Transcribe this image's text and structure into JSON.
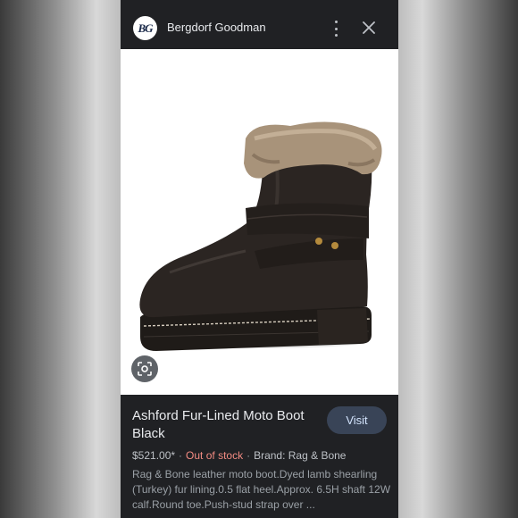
{
  "header": {
    "logo_text": "BG",
    "site_name": "Bergdorf Goodman"
  },
  "icons": {
    "more": "more-vert-icon",
    "close": "close-icon",
    "lens": "lens-search-icon"
  },
  "product": {
    "title": "Ashford Fur-Lined Moto Boot Black",
    "visit_label": "Visit",
    "price": "$521.00*",
    "stock_status": "Out of stock",
    "separator": "·",
    "brand": "Brand: Rag & Bone",
    "description": "Rag & Bone leather moto boot.Dyed lamb shearling (Turkey) fur lining.0.5 flat heel.Approx. 6.5H shaft 12W calf.Round toe.Push-stud strap over ..."
  },
  "colors": {
    "background": "#202124",
    "stock_status": "#f28b82",
    "visit_button": "#394457"
  }
}
